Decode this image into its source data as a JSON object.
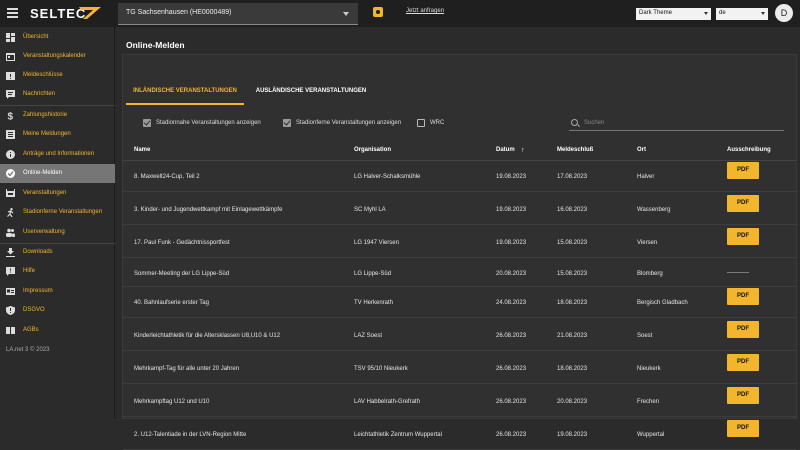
{
  "header": {
    "logo": "SELTEC",
    "org_select": "TG Sachsenhausen (HE0000489)",
    "request_link": "Jetzt anfragen",
    "theme_select": "Dark Theme",
    "lang_select": "de",
    "avatar_initial": "D"
  },
  "sidebar": {
    "items": [
      {
        "label": "Übersicht",
        "icon": "dashboard-icon"
      },
      {
        "label": "Veranstaltungskalender",
        "icon": "calendar-icon"
      },
      {
        "label": "Meldeschlüsse",
        "icon": "alert-calendar-icon"
      },
      {
        "label": "Nachrichten",
        "icon": "message-icon"
      },
      {
        "label": "Zahlungshistorie",
        "icon": "dollar-icon"
      },
      {
        "label": "Meine Meldungen",
        "icon": "list-icon"
      },
      {
        "label": "Anträge und Informationen",
        "icon": "info-icon"
      },
      {
        "label": "Online-Melden",
        "icon": "check-circle-icon"
      },
      {
        "label": "Veranstaltungen",
        "icon": "stadium-icon"
      },
      {
        "label": "Stadionferne Veranstaltungen",
        "icon": "runner-icon"
      },
      {
        "label": "Userverwaltung",
        "icon": "users-icon"
      },
      {
        "label": "Downloads",
        "icon": "download-icon"
      },
      {
        "label": "Hilfe",
        "icon": "help-icon"
      },
      {
        "label": "Impressum",
        "icon": "id-card-icon"
      },
      {
        "label": "DSGVO",
        "icon": "shield-icon"
      },
      {
        "label": "AGBs",
        "icon": "book-icon"
      }
    ],
    "copyright": "LA.net 3 © 2023"
  },
  "main": {
    "title": "Online-Melden",
    "tabs": [
      {
        "label": "INLÄNDISCHE VERANSTALTUNGEN"
      },
      {
        "label": "AUSLÄNDISCHE VERANSTALTUNGEN"
      }
    ],
    "filters": [
      {
        "label": "Stadionnahe Veranstaltungen anzeigen",
        "checked": true
      },
      {
        "label": "Stadionferne Veranstaltungen anzeigen",
        "checked": true
      },
      {
        "label": "WRC",
        "checked": false
      }
    ],
    "search_placeholder": "Suchen",
    "columns": {
      "name": "Name",
      "org": "Organisation",
      "date": "Datum",
      "sort_arrow": "↑",
      "deadline": "Meldeschluß",
      "place": "Ort",
      "pdf": "Ausschreibung"
    },
    "rows": [
      {
        "name": "8. Maxwelt24-Cup, Teil 2",
        "org": "LG Halver-Schalksmühle",
        "date": "19.08.2023",
        "deadline": "17.08.2023",
        "place": "Halver",
        "pdf": "PDF"
      },
      {
        "name": "3. Kinder- und Jugendwettkampf mit Einlagewettkämpfe",
        "org": "SC Myhl LA",
        "date": "19.08.2023",
        "deadline": "16.08.2023",
        "place": "Wassenberg",
        "pdf": "PDF"
      },
      {
        "name": "17. Paul Funk - Gedächtnissportfest",
        "org": "LG 1947 Viersen",
        "date": "19.08.2023",
        "deadline": "15.08.2023",
        "place": "Viersen",
        "pdf": "PDF"
      },
      {
        "name": "Sommer-Meeting der LG Lippe-Süd",
        "org": "LG Lippe-Süd",
        "date": "20.08.2023",
        "deadline": "15.08.2023",
        "place": "Blomberg",
        "pdf": "-----------"
      },
      {
        "name": "40. Bahnlaufserie erster Tag",
        "org": "TV Herkenrath",
        "date": "24.08.2023",
        "deadline": "18.08.2023",
        "place": "Bergisch Gladbach",
        "pdf": "PDF"
      },
      {
        "name": "Kinderleichtathletik für die Altersklassen U8,U10 & U12",
        "org": "LAZ Soest",
        "date": "26.08.2023",
        "deadline": "21.08.2023",
        "place": "Soest",
        "pdf": "PDF"
      },
      {
        "name": "Mehrkampf-Tag für alle unter 20 Jahren",
        "org": "TSV 95/10 Nieukerk",
        "date": "26.08.2023",
        "deadline": "18.08.2023",
        "place": "Nieukerk",
        "pdf": "PDF"
      },
      {
        "name": "Mehrkampftag U12 und U10",
        "org": "LAV Habbelrath-Grefrath",
        "date": "26.08.2023",
        "deadline": "20.08.2023",
        "place": "Frechen",
        "pdf": "PDF"
      },
      {
        "name": "2. U12-Talentiade in der LVN-Region Mitte",
        "org": "Leichtathletik Zentrum Wuppertal",
        "date": "26.08.2023",
        "deadline": "19.08.2023",
        "place": "Wuppertal",
        "pdf": "PDF"
      }
    ]
  },
  "colors": {
    "accent": "#f3b52e",
    "active_nav": "#767676",
    "background": "#2b2b2b"
  }
}
